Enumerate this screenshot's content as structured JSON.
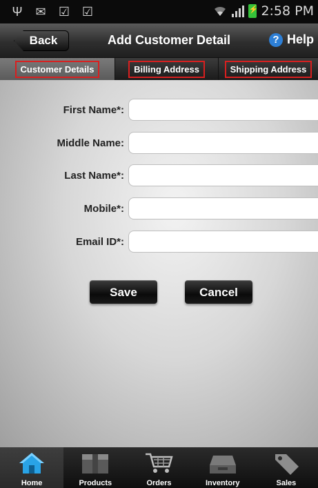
{
  "status_bar": {
    "icons": [
      "usb-icon",
      "mail-icon",
      "download-done-icon",
      "download-done-icon",
      "wifi-icon",
      "signal-icon",
      "battery-charging-icon"
    ],
    "time": "2:58 PM"
  },
  "title_bar": {
    "back_label": "Back",
    "title": "Add Customer Detail",
    "help_label": "Help"
  },
  "tabs": [
    {
      "label": "Customer Details",
      "active": true
    },
    {
      "label": "Billing Address",
      "active": false
    },
    {
      "label": "Shipping Address",
      "active": false
    }
  ],
  "form": {
    "fields": [
      {
        "label": "First Name*:",
        "value": ""
      },
      {
        "label": "Middle Name:",
        "value": ""
      },
      {
        "label": "Last Name*:",
        "value": ""
      },
      {
        "label": "Mobile*:",
        "value": ""
      },
      {
        "label": "Email ID*:",
        "value": ""
      }
    ],
    "save_label": "Save",
    "cancel_label": "Cancel"
  },
  "bottom_nav": {
    "items": [
      {
        "label": "Home",
        "icon": "home-icon",
        "active": true
      },
      {
        "label": "Products",
        "icon": "products-box-icon",
        "active": false
      },
      {
        "label": "Orders",
        "icon": "shopping-cart-icon",
        "active": false
      },
      {
        "label": "Inventory",
        "icon": "inventory-tray-icon",
        "active": false
      },
      {
        "label": "Sales",
        "icon": "price-tag-icon",
        "active": false
      }
    ]
  },
  "colors": {
    "tab_highlight_border": "#d91f1f",
    "help_icon": "#2d7fd6",
    "battery": "#35c23a"
  }
}
